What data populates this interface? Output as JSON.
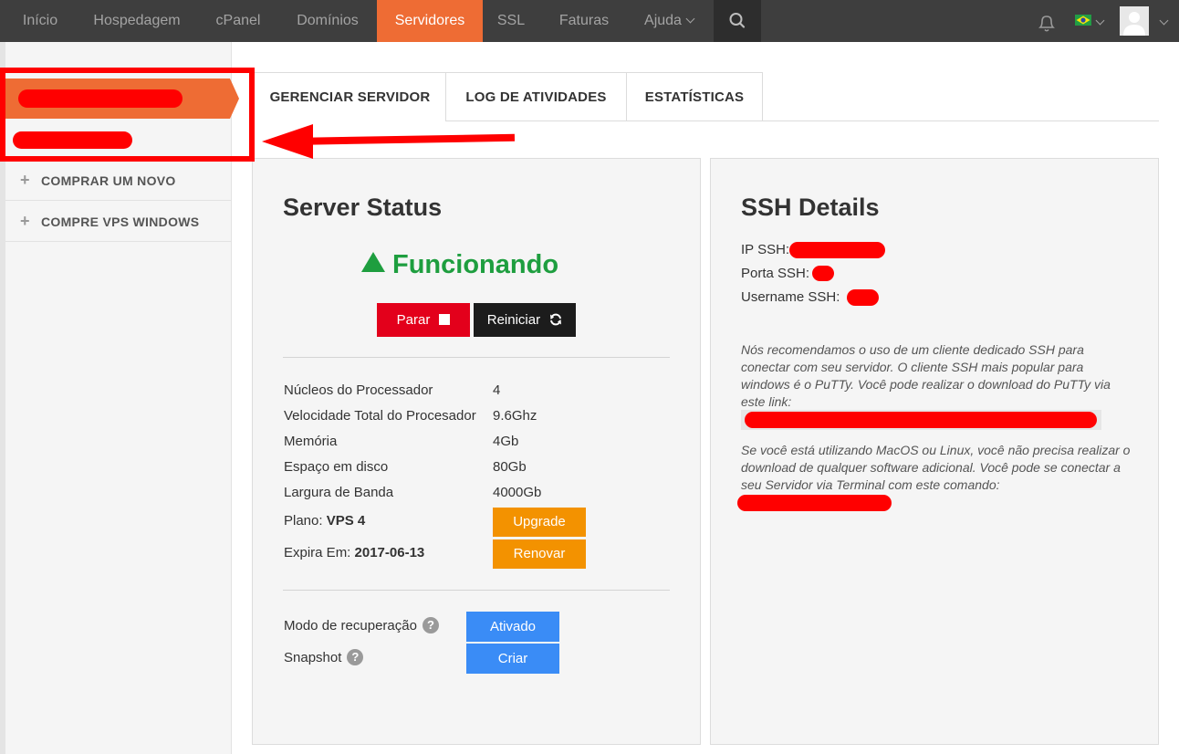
{
  "nav": {
    "items": [
      "Início",
      "Hospedagem",
      "cPanel",
      "Domínios",
      "Servidores",
      "SSL",
      "Faturas",
      "Ajuda"
    ],
    "active": "Servidores",
    "icons": [
      "search-icon",
      "bell-icon",
      "flag-brazil-icon",
      "avatar-icon"
    ]
  },
  "sidebar": {
    "items": [
      "COMPRAR UM NOVO",
      "COMPRE VPS WINDOWS"
    ]
  },
  "tabs": [
    "GERENCIAR SERVIDOR",
    "LOG DE ATIVIDADES",
    "ESTATÍSTICAS"
  ],
  "server_status": {
    "title": "Server Status",
    "status": "Funcionando",
    "stop_label": "Parar",
    "restart_label": "Reiniciar",
    "specs": [
      {
        "label": "Núcleos do Processador",
        "value": "4"
      },
      {
        "label": "Velocidade Total do Procesador",
        "value": "9.6Ghz"
      },
      {
        "label": "Memória",
        "value": "4Gb"
      },
      {
        "label": "Espaço em disco",
        "value": "80Gb"
      },
      {
        "label": "Largura de Banda",
        "value": "4000Gb"
      }
    ],
    "plan_label": "Plano:",
    "plan_value": "VPS 4",
    "upgrade_label": "Upgrade",
    "expires_label": "Expira Em:",
    "expires_value": "2017-06-13",
    "renew_label": "Renovar",
    "recovery_label": "Modo de recuperação",
    "recovery_button": "Ativado",
    "snapshot_label": "Snapshot",
    "snapshot_button": "Criar"
  },
  "ssh": {
    "title": "SSH Details",
    "ip_label": "IP SSH:",
    "port_label": "Porta SSH:",
    "user_label": "Username SSH:",
    "note1": "Nós recomendamos o uso de um cliente dedicado SSH para conectar com seu servidor. O cliente SSH mais popular para windows é o PuTTy. Você pode realizar o download do PuTTy via este link:",
    "note2": "Se você está utilizando MacOS ou Linux, você não precisa realizar o download de qualquer software adicional. Você pode se conectar a seu Servidor via Terminal com este comando:"
  },
  "colors": {
    "accent": "#ee6c34",
    "nav_bg": "#3e3e3e",
    "status_green": "#1e9e3f",
    "stop_red": "#e3001b",
    "orange_button": "#f39200",
    "blue_button": "#3a8cf6",
    "annotation_red": "#ff0000"
  }
}
